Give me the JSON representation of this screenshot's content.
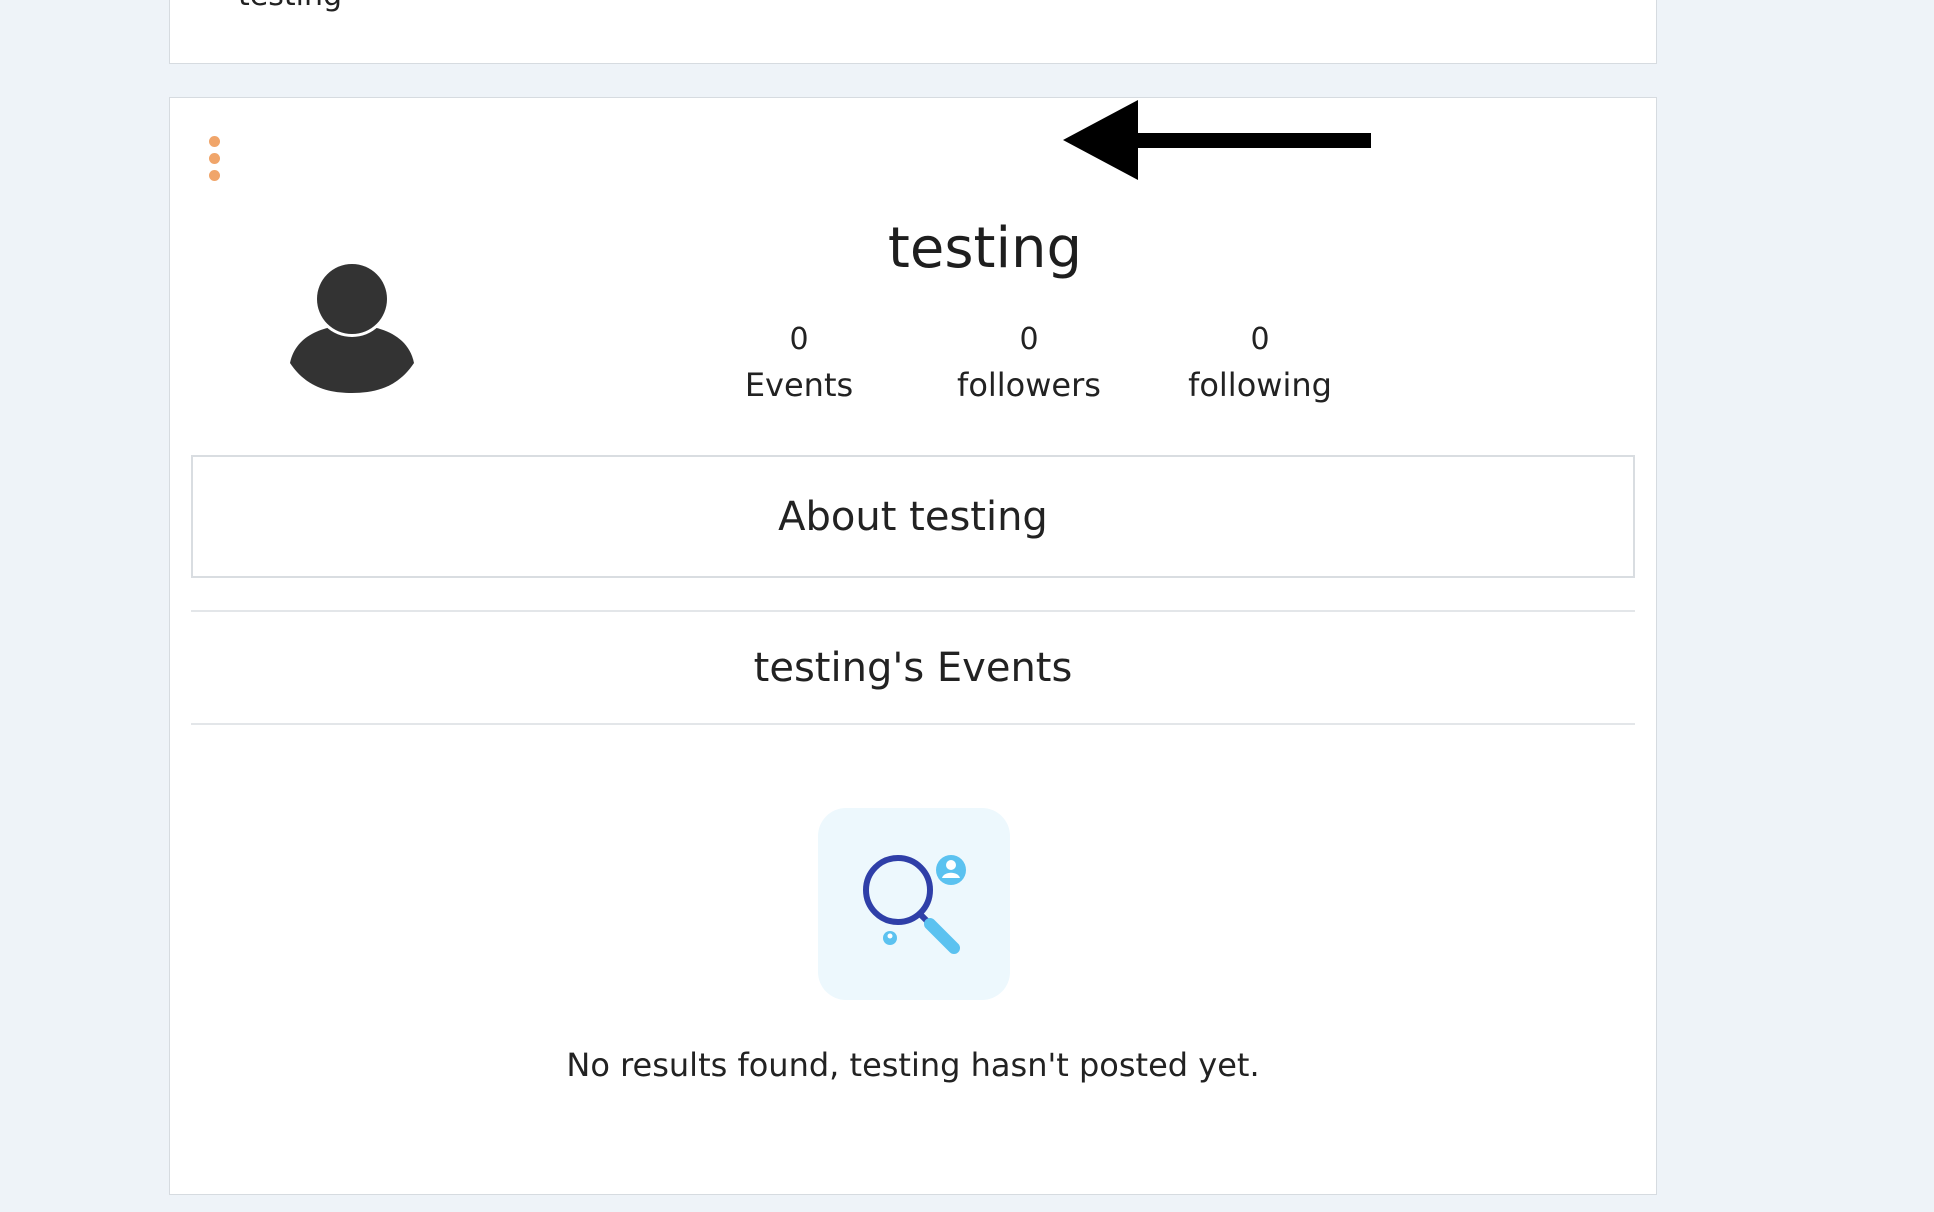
{
  "previous_card": {
    "name": "testing"
  },
  "profile": {
    "name": "testing",
    "menu_icon": "kebab-menu-icon",
    "avatar_icon": "user-silhouette-icon",
    "stats": [
      {
        "value": "0",
        "label": "Events"
      },
      {
        "value": "0",
        "label": "followers"
      },
      {
        "value": "0",
        "label": "following"
      }
    ],
    "about_label": "About testing",
    "events_heading": "testing's Events",
    "empty_state": {
      "icon": "magnifier-search-icon",
      "message": "No results found, testing hasn't posted yet."
    }
  },
  "annotation": {
    "icon": "left-arrow-icon"
  },
  "colors": {
    "page_background": "#eef3f8",
    "card_background": "#ffffff",
    "kebab_accent": "#f0a56a",
    "illustration_background": "#edf8fd",
    "magnifier_blue": "#2f3fa8",
    "magnifier_handle": "#5bc2f0"
  }
}
